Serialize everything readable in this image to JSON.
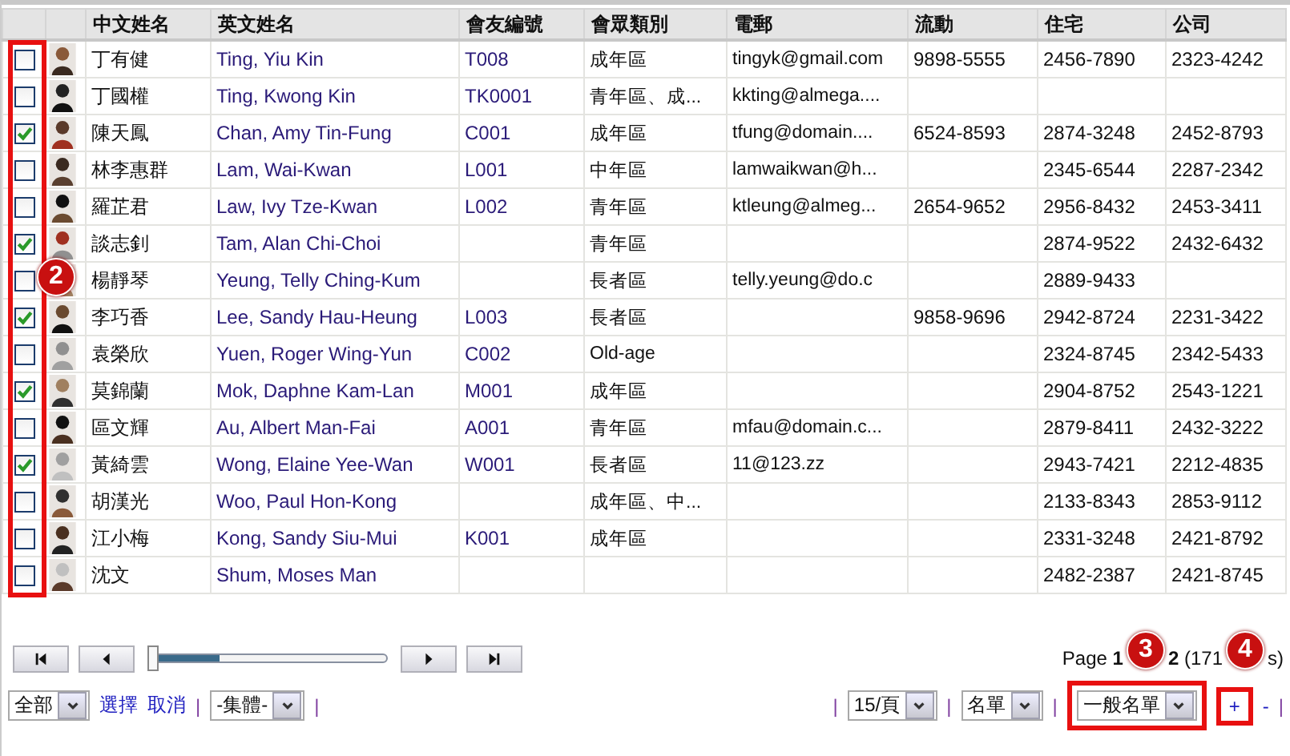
{
  "table": {
    "columns": [
      "中文姓名",
      "英文姓名",
      "會友編號",
      "會眾類別",
      "電郵",
      "流動",
      "住宅",
      "公司"
    ],
    "rows": [
      {
        "checked": false,
        "chinese_name": "丁有健",
        "english_name": "Ting, Yiu Kin",
        "member_id": "T008",
        "category": "成年區",
        "email": "tingyk@gmail.com",
        "mobile": "9898-5555",
        "home": "2456-7890",
        "office": "2323-4242"
      },
      {
        "checked": false,
        "chinese_name": "丁國權",
        "english_name": "Ting, Kwong Kin",
        "member_id": "TK0001",
        "category": "青年區、成...",
        "email": "kkting@almega....",
        "mobile": "",
        "home": "",
        "office": ""
      },
      {
        "checked": true,
        "chinese_name": "陳天鳳",
        "english_name": "Chan, Amy Tin-Fung",
        "member_id": "C001",
        "category": "成年區",
        "email": "tfung@domain....",
        "mobile": "6524-8593",
        "home": "2874-3248",
        "office": "2452-8793"
      },
      {
        "checked": false,
        "chinese_name": "林李惠群",
        "english_name": "Lam, Wai-Kwan",
        "member_id": "L001",
        "category": "中年區",
        "email": "lamwaikwan@h...",
        "mobile": "",
        "home": "2345-6544",
        "office": "2287-2342"
      },
      {
        "checked": false,
        "chinese_name": "羅芷君",
        "english_name": "Law, Ivy Tze-Kwan",
        "member_id": "L002",
        "category": "青年區",
        "email": "ktleung@almeg...",
        "mobile": "2654-9652",
        "home": "2956-8432",
        "office": "2453-3411"
      },
      {
        "checked": true,
        "chinese_name": "談志釗",
        "english_name": "Tam, Alan Chi-Choi",
        "member_id": "",
        "category": "青年區",
        "email": "",
        "mobile": "",
        "home": "2874-9522",
        "office": "2432-6432"
      },
      {
        "checked": false,
        "chinese_name": "楊靜琴",
        "english_name": "Yeung, Telly Ching-Kum",
        "member_id": "",
        "category": "長者區",
        "email": "telly.yeung@do.c",
        "mobile": "",
        "home": "2889-9433",
        "office": ""
      },
      {
        "checked": true,
        "chinese_name": "李巧香",
        "english_name": "Lee, Sandy Hau-Heung",
        "member_id": "L003",
        "category": "長者區",
        "email": "",
        "mobile": "9858-9696",
        "home": "2942-8724",
        "office": "2231-3422"
      },
      {
        "checked": false,
        "chinese_name": "袁榮欣",
        "english_name": "Yuen, Roger Wing-Yun",
        "member_id": "C002",
        "category": "Old-age",
        "email": "",
        "mobile": "",
        "home": "2324-8745",
        "office": "2342-5433"
      },
      {
        "checked": true,
        "chinese_name": "莫錦蘭",
        "english_name": "Mok, Daphne Kam-Lan",
        "member_id": "M001",
        "category": "成年區",
        "email": "",
        "mobile": "",
        "home": "2904-8752",
        "office": "2543-1221"
      },
      {
        "checked": false,
        "chinese_name": "區文輝",
        "english_name": "Au, Albert Man-Fai",
        "member_id": "A001",
        "category": "青年區",
        "email": "mfau@domain.c...",
        "mobile": "",
        "home": "2879-8411",
        "office": "2432-3222"
      },
      {
        "checked": true,
        "chinese_name": "黃綺雲",
        "english_name": "Wong, Elaine Yee-Wan",
        "member_id": "W001",
        "category": "長者區",
        "email": "11@123.zz",
        "mobile": "",
        "home": "2943-7421",
        "office": "2212-4835"
      },
      {
        "checked": false,
        "chinese_name": "胡漢光",
        "english_name": "Woo, Paul Hon-Kong",
        "member_id": "",
        "category": "成年區、中...",
        "email": "",
        "mobile": "",
        "home": "2133-8343",
        "office": "2853-9112"
      },
      {
        "checked": false,
        "chinese_name": "江小梅",
        "english_name": "Kong, Sandy Siu-Mui",
        "member_id": "K001",
        "category": "成年區",
        "email": "",
        "mobile": "",
        "home": "2331-3248",
        "office": "2421-8792"
      },
      {
        "checked": false,
        "chinese_name": "沈文",
        "english_name": "Shum, Moses Man",
        "member_id": "",
        "category": "",
        "email": "",
        "mobile": "",
        "home": "2482-2387",
        "office": "2421-8745"
      }
    ]
  },
  "pager": {
    "level": 0.3,
    "page_info": [
      "Page **1**",
      "**2** (171",
      "s)"
    ]
  },
  "toolbar_left": [
    {
      "kind": "select",
      "value": "全部"
    },
    {
      "kind": "link",
      "label": "選擇"
    },
    {
      "kind": "link",
      "label": "取消"
    },
    {
      "kind": "separator",
      "label": "|"
    },
    {
      "kind": "select",
      "value": "-集體-"
    },
    {
      "kind": "separator",
      "label": "|"
    }
  ],
  "toolbar_right": [
    {
      "kind": "separator",
      "label": "|"
    },
    {
      "kind": "select",
      "value": "15/頁"
    },
    {
      "kind": "separator",
      "label": "|"
    },
    {
      "kind": "select",
      "value": "名單"
    },
    {
      "kind": "separator",
      "label": "|"
    },
    {
      "kind": "select",
      "value": "一般名單"
    },
    {
      "kind": "link",
      "label": "+"
    },
    {
      "kind": "link",
      "label": "-"
    },
    {
      "kind": "separator",
      "label": "|"
    }
  ],
  "callouts": [
    "2",
    "3",
    "4"
  ]
}
